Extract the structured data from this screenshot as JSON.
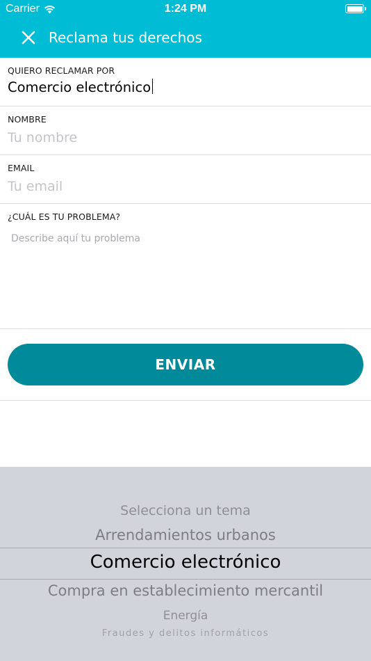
{
  "status_bar": {
    "carrier": "Carrier",
    "time": "1:24 PM",
    "wifi_icon": "wifi-icon",
    "battery_icon": "battery-icon"
  },
  "nav": {
    "title": "Reclama tus derechos",
    "close_icon": "close-icon",
    "color": "#00bcd4"
  },
  "form": {
    "topic": {
      "label": "QUIERO RECLAMAR POR",
      "value": "Comercio electrónico"
    },
    "name": {
      "label": "NOMBRE",
      "placeholder": "Tu nombre",
      "value": ""
    },
    "email": {
      "label": "EMAIL",
      "placeholder": "Tu email",
      "value": ""
    },
    "problem": {
      "label": "¿CUÁL ES TU PROBLEMA?",
      "placeholder": "Describe aquí tu problema",
      "value": ""
    },
    "submit_label": "ENVIAR",
    "submit_color": "#008a9a"
  },
  "picker": {
    "options": [
      "Selecciona un tema",
      "Arrendamientos urbanos",
      "Comercio electrónico",
      "Compra en establecimiento mercantil",
      "Energía",
      "Fraudes y delitos informáticos"
    ],
    "selected": "Comercio electrónico",
    "background": "#d1d4db"
  }
}
